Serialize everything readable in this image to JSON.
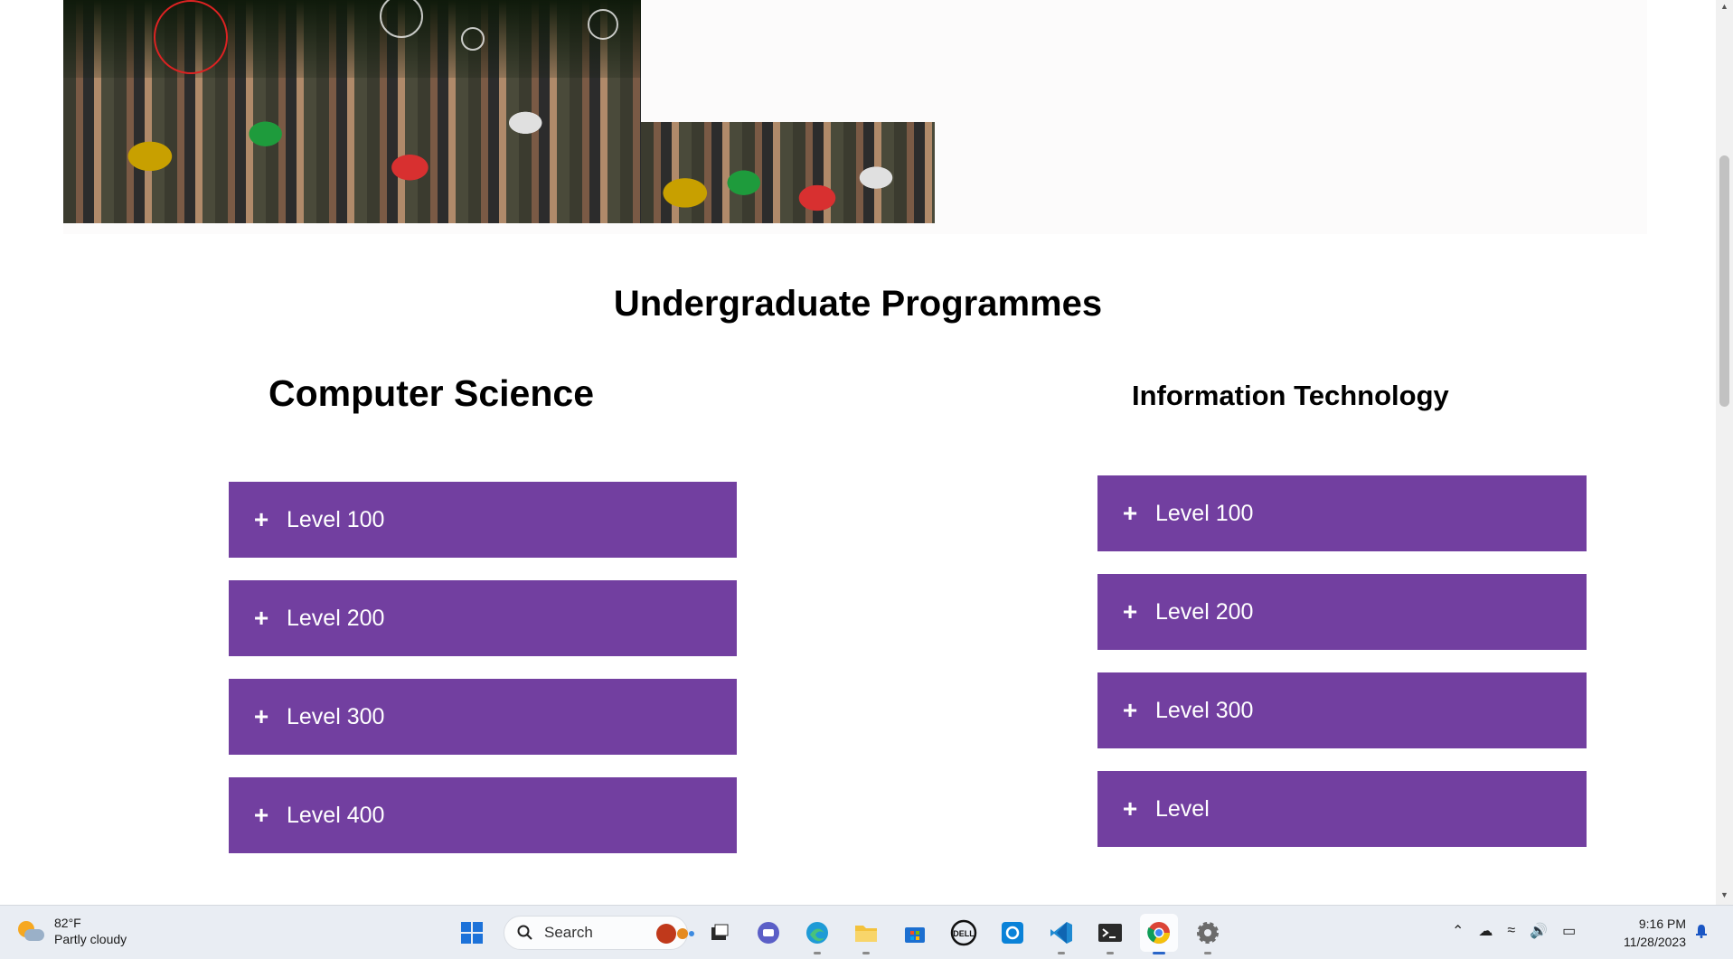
{
  "page": {
    "section_title": "Undergraduate Programmes",
    "accent_color": "#723fa0"
  },
  "programmes": [
    {
      "title": "Computer Science",
      "levels": [
        "Level 100",
        "Level 200",
        "Level 300",
        "Level 400"
      ]
    },
    {
      "title": "Information Technology",
      "levels": [
        "Level 100",
        "Level 200",
        "Level 300",
        "Level"
      ]
    }
  ],
  "accordion_icon": "plus-icon",
  "taskbar": {
    "weather": {
      "temp": "82°F",
      "condition": "Partly cloudy",
      "icon": "partly-cloudy-icon"
    },
    "search_label": "Search",
    "apps": [
      "start-icon",
      "search-icon",
      "task-view-icon",
      "teams-icon",
      "edge-icon",
      "file-explorer-icon",
      "store-icon",
      "dell-icon",
      "cortana-icon",
      "vscode-icon",
      "terminal-icon",
      "chrome-icon",
      "settings-icon"
    ],
    "tray_icons": [
      "chevron-up-icon",
      "onedrive-icon",
      "wifi-icon",
      "volume-icon",
      "battery-icon"
    ],
    "time": "9:16 PM",
    "date": "11/28/2023"
  }
}
